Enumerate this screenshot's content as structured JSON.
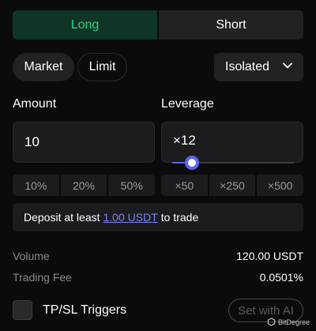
{
  "side": {
    "long_label": "Long",
    "short_label": "Short",
    "selected": "Long"
  },
  "order_type": {
    "market_label": "Market",
    "limit_label": "Limit",
    "selected": "Market"
  },
  "margin_mode": {
    "value": "Isolated"
  },
  "amount": {
    "label": "Amount",
    "value": "10",
    "quick": [
      "10%",
      "20%",
      "50%"
    ]
  },
  "leverage": {
    "label": "Leverage",
    "value": "×12",
    "slider_fraction": 0.16,
    "quick": [
      "×50",
      "×250",
      "×500"
    ]
  },
  "notice": {
    "prefix": "Deposit at least",
    "amount_link": "1.00 USDT",
    "suffix": "to trade"
  },
  "info": {
    "volume_label": "Volume",
    "volume_value": "120.00 USDT",
    "fee_label": "Trading Fee",
    "fee_value": "0.0501%"
  },
  "tpsl": {
    "label": "TP/SL Triggers",
    "checked": false,
    "ai_button": "Set with AI"
  },
  "watermark": {
    "text": "BitDegree"
  },
  "colors": {
    "long_green": "#2fd27f",
    "accent": "#5b63f5",
    "link": "#7b83ff"
  }
}
